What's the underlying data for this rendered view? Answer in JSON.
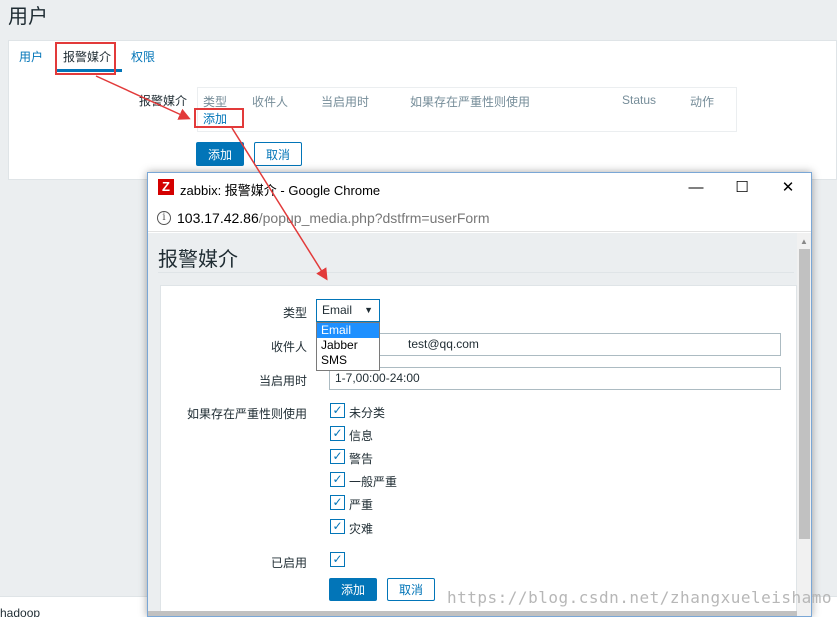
{
  "page": {
    "title": "用户",
    "tabs": [
      "用户",
      "报警媒介",
      "权限"
    ],
    "form_label": "报警媒介",
    "table_headers": [
      "类型",
      "收件人",
      "当启用时",
      "如果存在严重性则使用",
      "Status",
      "动作"
    ],
    "add_link": "添加",
    "add_button": "添加",
    "cancel_button": "取消",
    "bottom_text": "hadoop"
  },
  "popup": {
    "window_title": "zabbix: 报警媒介 - Google Chrome",
    "logo_letter": "Z",
    "controls": [
      "—",
      "☐",
      "✕"
    ],
    "url_host": "103.17.42.86",
    "url_path": "/popup_media.php?dstfrm=userForm",
    "heading": "报警媒介",
    "labels": {
      "type": "类型",
      "recipient": "收件人",
      "when_active": "当启用时",
      "severity": "如果存在严重性则使用",
      "enabled": "已启用"
    },
    "type_selected": "Email",
    "type_options": [
      "Email",
      "Jabber",
      "SMS"
    ],
    "recipient_value": "test@qq.com",
    "when_active_value": "1-7,00:00-24:00",
    "severities": [
      {
        "label": "未分类",
        "checked": true
      },
      {
        "label": "信息",
        "checked": true
      },
      {
        "label": "警告",
        "checked": true
      },
      {
        "label": "一般严重",
        "checked": true
      },
      {
        "label": "严重",
        "checked": true
      },
      {
        "label": "灾难",
        "checked": true
      }
    ],
    "enabled_checked": true,
    "add_button": "添加",
    "cancel_button": "取消"
  },
  "watermark": "https://blog.csdn.net/zhangxueleishamo",
  "colors": {
    "accent": "#0275b8",
    "annotation": "#e23a3a",
    "brand": "#d40000"
  }
}
